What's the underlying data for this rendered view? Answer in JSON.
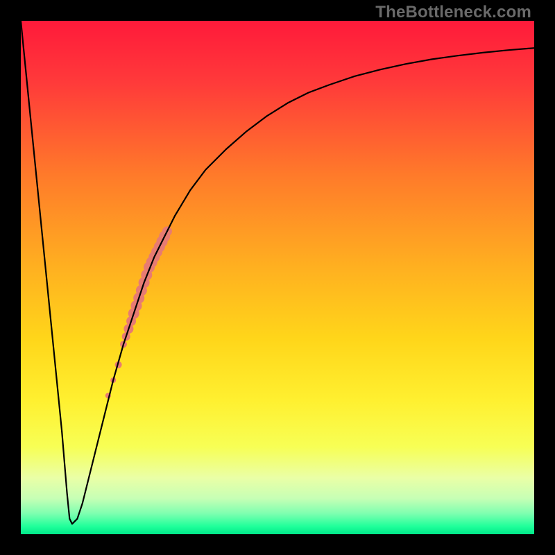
{
  "watermark": "TheBottleneck.com",
  "colors": {
    "frame": "#000000",
    "curve": "#000000",
    "dots": "#e77b72",
    "gradient_stops": [
      {
        "offset": 0.0,
        "color": "#ff1a3a"
      },
      {
        "offset": 0.12,
        "color": "#ff3a3a"
      },
      {
        "offset": 0.3,
        "color": "#ff7a2a"
      },
      {
        "offset": 0.48,
        "color": "#ffb020"
      },
      {
        "offset": 0.62,
        "color": "#ffd61a"
      },
      {
        "offset": 0.74,
        "color": "#fff030"
      },
      {
        "offset": 0.83,
        "color": "#f7ff55"
      },
      {
        "offset": 0.89,
        "color": "#eaffa6"
      },
      {
        "offset": 0.93,
        "color": "#c7ffb5"
      },
      {
        "offset": 0.96,
        "color": "#7dffb0"
      },
      {
        "offset": 0.985,
        "color": "#1fff9a"
      },
      {
        "offset": 1.0,
        "color": "#00e88a"
      }
    ]
  },
  "chart_data": {
    "type": "line",
    "title": "",
    "xlabel": "",
    "ylabel": "",
    "xlim": [
      0,
      100
    ],
    "ylim": [
      0,
      100
    ],
    "series": [
      {
        "name": "bottleneck-curve",
        "x": [
          0,
          2,
          4,
          6,
          8,
          9,
          9.5,
          10,
          11,
          12,
          14,
          16,
          18,
          20,
          22,
          24,
          26,
          28,
          30,
          33,
          36,
          40,
          44,
          48,
          52,
          56,
          60,
          65,
          70,
          75,
          80,
          85,
          90,
          95,
          100
        ],
        "y": [
          100,
          80,
          60,
          40,
          20,
          8,
          3,
          2,
          3,
          6,
          14,
          22,
          30,
          37,
          43,
          49,
          54,
          58,
          62,
          67,
          71,
          75,
          78.5,
          81.5,
          84,
          86,
          87.5,
          89.2,
          90.5,
          91.6,
          92.5,
          93.2,
          93.8,
          94.3,
          94.7
        ]
      }
    ],
    "highlight_segment": {
      "name": "salmon-dot-band",
      "x": [
        17,
        18,
        19,
        20,
        20.5,
        21,
        21.5,
        22,
        22.5,
        23,
        23.5,
        24,
        24.5,
        25,
        25.5,
        26,
        26.5,
        27,
        27.5,
        28,
        28.5
      ],
      "y": [
        27,
        30,
        33,
        37,
        38.5,
        40,
        41.5,
        43,
        44.5,
        46,
        47.5,
        49,
        50.5,
        52,
        53,
        54,
        55,
        56,
        57,
        58,
        59
      ],
      "radius": [
        4,
        4,
        5,
        5,
        6,
        7,
        7,
        8,
        8,
        8,
        8,
        8,
        8,
        8,
        8,
        8,
        8,
        8,
        8,
        8,
        7
      ]
    },
    "minimum_at": {
      "x": 9.7,
      "y": 2
    }
  }
}
